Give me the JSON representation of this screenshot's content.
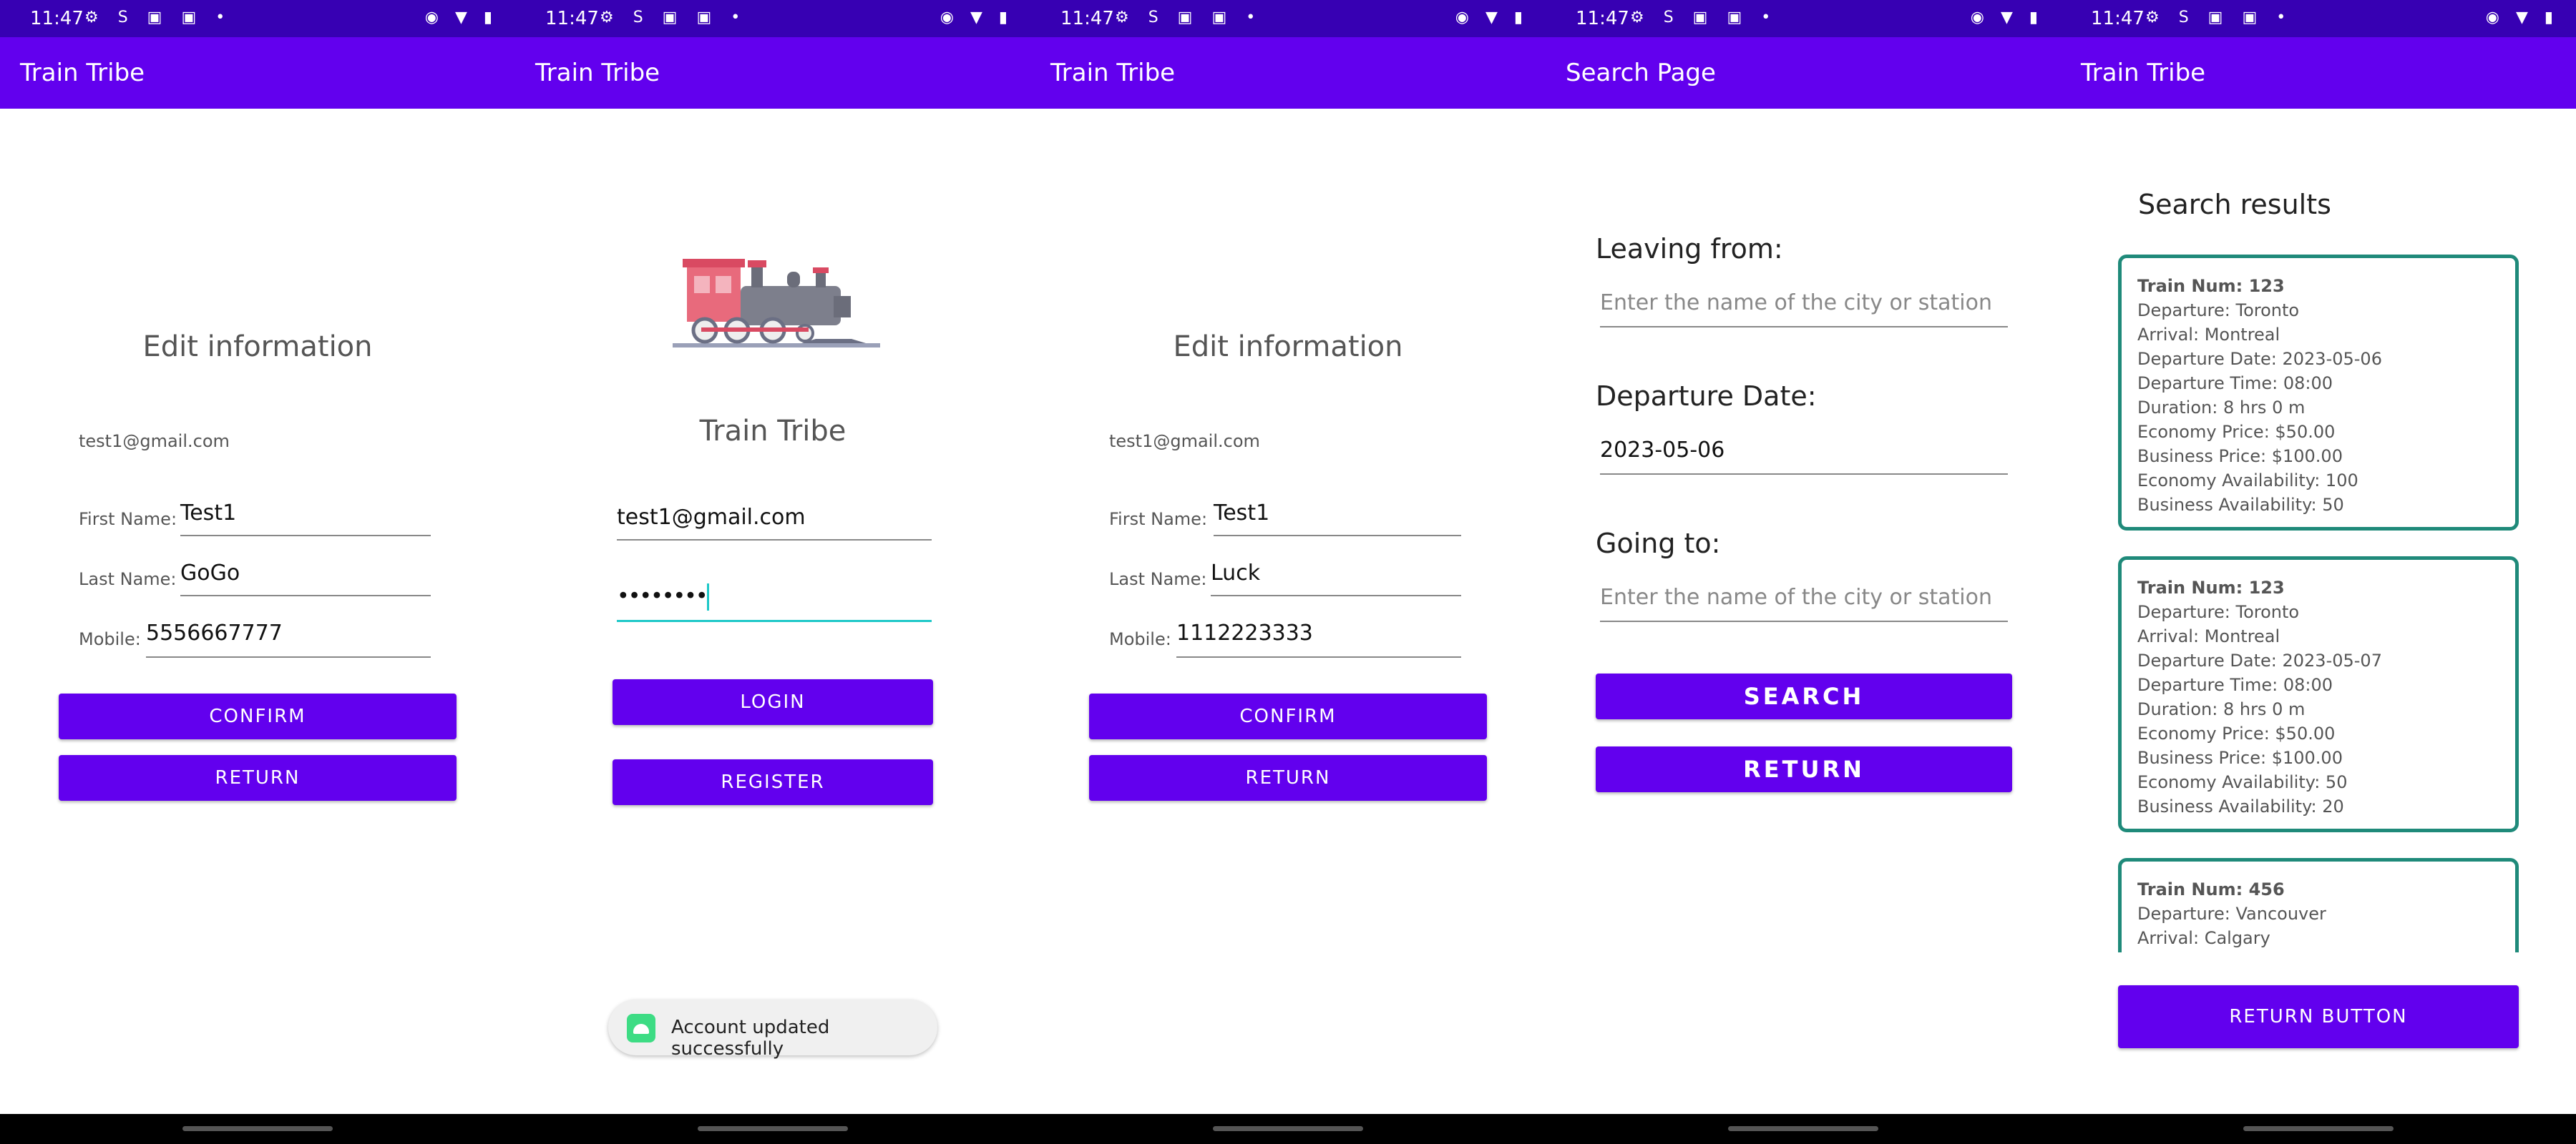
{
  "status": {
    "time": "11:47"
  },
  "screen1": {
    "app_title": "Train Tribe",
    "heading": "Edit information",
    "email": "test1@gmail.com",
    "first_name_label": "First Name:",
    "first_name_value": "Test1",
    "last_name_label": "Last Name:",
    "last_name_value": "GoGo",
    "mobile_label": "Mobile:",
    "mobile_value": "5556667777",
    "confirm_label": "CONFIRM",
    "return_label": "RETURN"
  },
  "screen2": {
    "app_title": "Train Tribe",
    "logo_text": "Train Tribe",
    "email_value": "test1@gmail.com",
    "password_value": "••••••••",
    "login_label": "LOGIN",
    "register_label": "REGISTER",
    "toast_text": "Account updated successfully"
  },
  "screen3": {
    "app_title": "Train Tribe",
    "heading": "Edit information",
    "email": "test1@gmail.com",
    "first_name_label": "First Name:",
    "first_name_value": "Test1",
    "last_name_label": "Last Name:",
    "last_name_value": "Luck",
    "mobile_label": "Mobile:",
    "mobile_value": "1112223333",
    "confirm_label": "CONFIRM",
    "return_label": "RETURN"
  },
  "screen4": {
    "app_title": "Search Page",
    "leaving_label": "Leaving from:",
    "leaving_placeholder": "Enter the name of the city or station",
    "date_label": "Departure Date:",
    "date_value": "2023-05-06",
    "going_label": "Going to:",
    "going_placeholder": "Enter the name of the city or station",
    "search_label": "SEARCH",
    "return_label": "RETURN"
  },
  "screen5": {
    "app_title": "Train Tribe",
    "heading": "Search results",
    "results": [
      {
        "num": "Train Num: 123",
        "lines": [
          "Departure: Toronto",
          "Arrival: Montreal",
          "Departure Date: 2023-05-06",
          "Departure Time: 08:00",
          "Duration: 8 hrs 0 m",
          "Economy Price: $50.00",
          "Business Price: $100.00",
          "Economy Availability: 100",
          "Business Availability: 50"
        ]
      },
      {
        "num": "Train Num: 123",
        "lines": [
          "Departure: Toronto",
          "Arrival: Montreal",
          "Departure Date: 2023-05-07",
          "Departure Time: 08:00",
          "Duration: 8 hrs 0 m",
          "Economy Price: $50.00",
          "Business Price: $100.00",
          "Economy Availability: 50",
          "Business Availability: 20"
        ]
      },
      {
        "num": "Train Num: 456",
        "lines": [
          "Departure: Vancouver",
          "Arrival: Calgary"
        ]
      }
    ],
    "return_button_label": "RETURN BUTTON"
  },
  "colors": {
    "status_bar": "#3700b3",
    "app_bar": "#6200ee",
    "button": "#6200ee",
    "card_border": "#1f8a7a",
    "focus_underline": "#1ec8c8"
  }
}
